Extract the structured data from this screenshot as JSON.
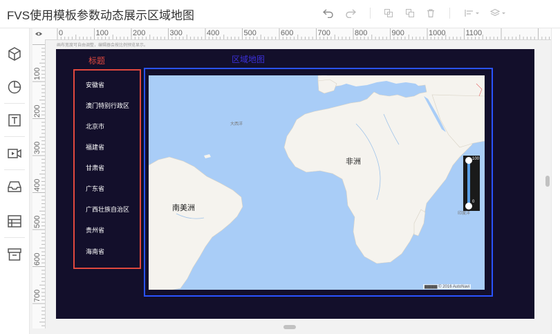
{
  "app": {
    "title": "FVS使用模板参数动态展示区域地图"
  },
  "toolbar": {
    "icons": [
      "undo-icon",
      "redo-icon",
      "copy-icon",
      "paste-icon",
      "delete-icon",
      "align-icon",
      "layer-icon"
    ]
  },
  "sidebar": {
    "items": [
      "cube-icon",
      "chart-pie-icon",
      "text-icon",
      "video-icon",
      "inbox-icon",
      "table-icon",
      "archive-icon"
    ]
  },
  "ruler": {
    "top": [
      "0",
      "100",
      "200",
      "300",
      "400",
      "500",
      "600",
      "700",
      "800",
      "900",
      "1000",
      "1100"
    ],
    "left": [
      "100",
      "200",
      "300",
      "400",
      "500",
      "600",
      "700"
    ]
  },
  "canvas": {
    "hint": "画布宽度可自由调整，编辑器会按比例预览显示。",
    "list_title": "标题",
    "map_title": "区域地图",
    "list_items": [
      "安徽省",
      "澳门特别行政区",
      "北京市",
      "福建省",
      "甘肃省",
      "广东省",
      "广西壮族自治区",
      "贵州省",
      "海南省"
    ]
  },
  "map": {
    "labels": {
      "africa": "非洲",
      "south_america": "南美洲",
      "atlantic": "大西洋",
      "indian_ocean": "印度洋"
    },
    "legend": {
      "max": "100",
      "min": "0"
    },
    "attribution": "▆▆▆▆ © 2016 AutoNavi"
  },
  "colors": {
    "list_title": "#e0483e",
    "map_title": "#3b2fd6",
    "board": "#130f2b",
    "ocean": "#a9cdf7",
    "land": "#f5f3ee"
  }
}
